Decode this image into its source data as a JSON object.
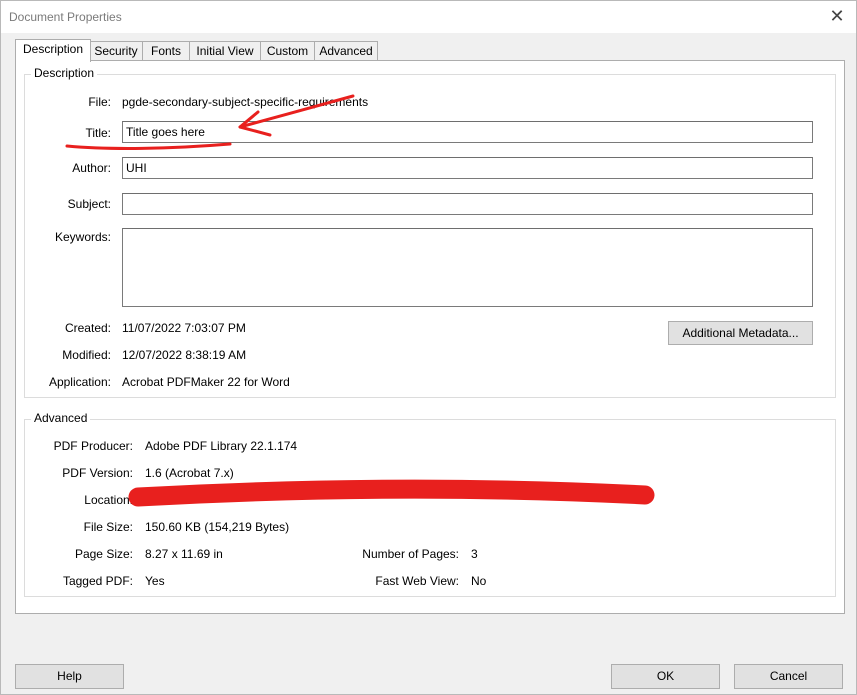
{
  "window": {
    "title": "Document Properties",
    "close_glyph": "✕"
  },
  "tabs": [
    {
      "label": "Description"
    },
    {
      "label": "Security"
    },
    {
      "label": "Fonts"
    },
    {
      "label": "Initial View"
    },
    {
      "label": "Custom"
    },
    {
      "label": "Advanced"
    }
  ],
  "description": {
    "group_label": "Description",
    "file_label": "File:",
    "file_value": "pgde-secondary-subject-specific-requirements",
    "title_label": "Title:",
    "title_value": "Title goes here",
    "author_label": "Author:",
    "author_value": "UHI",
    "subject_label": "Subject:",
    "subject_value": "",
    "keywords_label": "Keywords:",
    "keywords_value": "",
    "created_label": "Created:",
    "created_value": "11/07/2022 7:03:07 PM",
    "modified_label": "Modified:",
    "modified_value": "12/07/2022 8:38:19 AM",
    "application_label": "Application:",
    "application_value": "Acrobat PDFMaker 22 for Word",
    "metadata_button": "Additional Metadata..."
  },
  "advanced": {
    "group_label": "Advanced",
    "producer_label": "PDF Producer:",
    "producer_value": "Adobe PDF Library 22.1.174",
    "version_label": "PDF Version:",
    "version_value": "1.6 (Acrobat 7.x)",
    "location_label": "Location:",
    "filesize_label": "File Size:",
    "filesize_value": "150.60 KB (154,219 Bytes)",
    "pagesize_label": "Page Size:",
    "pagesize_value": "8.27 x 11.69 in",
    "pages_label": "Number of Pages:",
    "pages_value": "3",
    "tagged_label": "Tagged PDF:",
    "tagged_value": "Yes",
    "fastweb_label": "Fast Web View:",
    "fastweb_value": "No"
  },
  "footer": {
    "help": "Help",
    "ok": "OK",
    "cancel": "Cancel"
  },
  "colors": {
    "annotation_red": "#e8201e",
    "tab_border": "#adadad",
    "button_face": "#e1e1e1"
  }
}
